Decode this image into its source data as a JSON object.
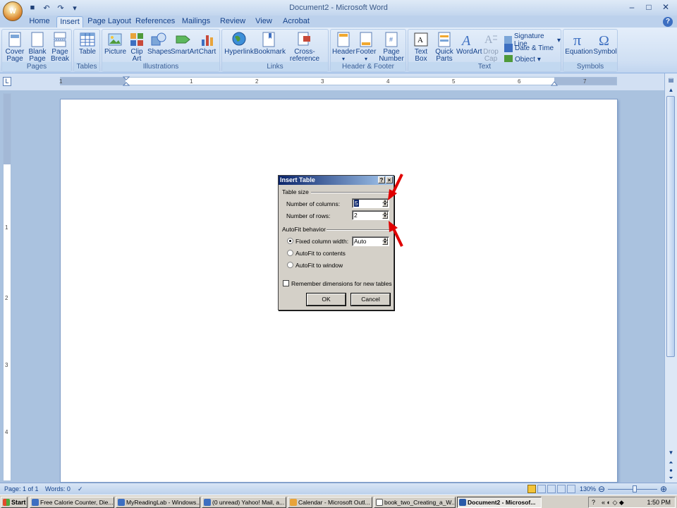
{
  "window": {
    "title": "Document2 - Microsoft Word",
    "orb_label": "W"
  },
  "tabs": [
    "Home",
    "Insert",
    "Page Layout",
    "References",
    "Mailings",
    "Review",
    "View",
    "Acrobat"
  ],
  "ribbon": {
    "groups": [
      "Pages",
      "Tables",
      "Illustrations",
      "Links",
      "Header & Footer",
      "Text",
      "Symbols"
    ],
    "pages": [
      "Cover Page",
      "Blank Page",
      "Page Break"
    ],
    "tables": [
      "Table"
    ],
    "illustrations": [
      "Picture",
      "Clip Art",
      "Shapes",
      "SmartArt",
      "Chart"
    ],
    "links": [
      "Hyperlink",
      "Bookmark",
      "Cross-reference"
    ],
    "header_footer": [
      "Header",
      "Footer",
      "Page Number"
    ],
    "text": [
      "Text Box",
      "Quick Parts",
      "WordArt",
      "Drop Cap"
    ],
    "text_small": [
      "Signature Line",
      "Date & Time",
      "Object"
    ],
    "symbols": [
      "Equation",
      "Symbol"
    ]
  },
  "ruler": {
    "h_ticks": [
      "1",
      "1",
      "2",
      "3",
      "4",
      "5",
      "6",
      "7"
    ],
    "v_ticks": [
      "1",
      "2",
      "3",
      "4"
    ]
  },
  "dialog": {
    "title": "Insert Table",
    "help": "?",
    "close": "×",
    "table_size": "Table size",
    "columns_label": "Number of columns:",
    "columns_value": "5",
    "rows_label": "Number of rows:",
    "rows_value": "2",
    "autofit": "AutoFit behavior",
    "fixed_label": "Fixed column width:",
    "fixed_value": "Auto",
    "contents_label": "AutoFit to contents",
    "window_label": "AutoFit to window",
    "remember_label": "Remember dimensions for new tables",
    "ok": "OK",
    "cancel": "Cancel"
  },
  "status": {
    "page": "Page: 1 of 1",
    "words": "Words: 0",
    "zoom": "130%"
  },
  "taskbar": {
    "start": "Start",
    "tasks": [
      "Free Calorie Counter, Die...",
      "MyReadingLab - Windows...",
      "(0 unread) Yahoo! Mail, a...",
      "Calendar - Microsoft Outl...",
      "book_two_Creating_a_W...",
      "Document2 - Microsof..."
    ],
    "clock": "1:50 PM"
  },
  "colors": {
    "arrow": "#e00000",
    "title_gradient_start": "#0a246a"
  }
}
